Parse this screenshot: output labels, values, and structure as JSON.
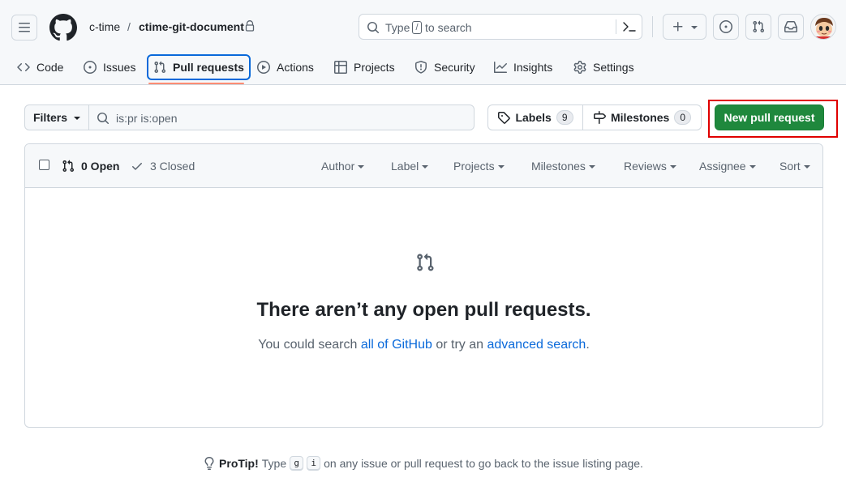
{
  "header": {
    "owner": "c-time",
    "separator": "/",
    "repo": "ctime-git-document",
    "search_prefix": "Type",
    "search_key": "/",
    "search_suffix": "to search"
  },
  "tabs": [
    {
      "label": "Code",
      "icon": "code-icon"
    },
    {
      "label": "Issues",
      "icon": "issue-opened-icon"
    },
    {
      "label": "Pull requests",
      "icon": "git-pull-request-icon",
      "selected": true
    },
    {
      "label": "Actions",
      "icon": "play-icon"
    },
    {
      "label": "Projects",
      "icon": "table-icon"
    },
    {
      "label": "Security",
      "icon": "shield-icon"
    },
    {
      "label": "Insights",
      "icon": "graph-icon"
    },
    {
      "label": "Settings",
      "icon": "gear-icon"
    }
  ],
  "toolbar": {
    "filters_label": "Filters",
    "filter_query": "is:pr is:open",
    "labels_label": "Labels",
    "labels_count": "9",
    "milestones_label": "Milestones",
    "milestones_count": "0",
    "new_pr_label": "New pull request"
  },
  "list": {
    "open_label": "0 Open",
    "closed_label": "3 Closed",
    "filters": [
      "Author",
      "Label",
      "Projects",
      "Milestones",
      "Reviews",
      "Assignee",
      "Sort"
    ]
  },
  "empty": {
    "title": "There aren’t any open pull requests.",
    "desc_prefix": "You could search",
    "link1": "all of GitHub",
    "desc_mid": "or try an",
    "link2": "advanced search",
    "desc_suffix": "."
  },
  "protip": {
    "label": "ProTip!",
    "text1": "Type",
    "key1": "g",
    "key2": "i",
    "text2": "on any issue or pull request to go back to the issue listing page."
  },
  "colors": {
    "accent": "#0969da",
    "primary_button": "#1f883d",
    "tab_underline": "#fd8c73",
    "highlight": "#e00000"
  }
}
